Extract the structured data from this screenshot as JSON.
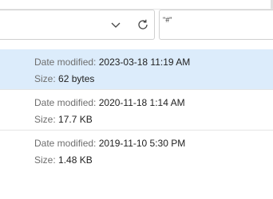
{
  "search": {
    "text": "\"#\""
  },
  "labels": {
    "date_modified": "Date modified:",
    "size": "Size:"
  },
  "items": [
    {
      "date": "2023-03-18 11:19 AM",
      "size": "62 bytes",
      "selected": true
    },
    {
      "date": "2020-11-18 1:14 AM",
      "size": "17.7 KB",
      "selected": false
    },
    {
      "date": "2019-11-10 5:30 PM",
      "size": "1.48 KB",
      "selected": false
    }
  ],
  "colors": {
    "selected_background": "#dcecfb",
    "label_gray": "#6e6e6e"
  }
}
